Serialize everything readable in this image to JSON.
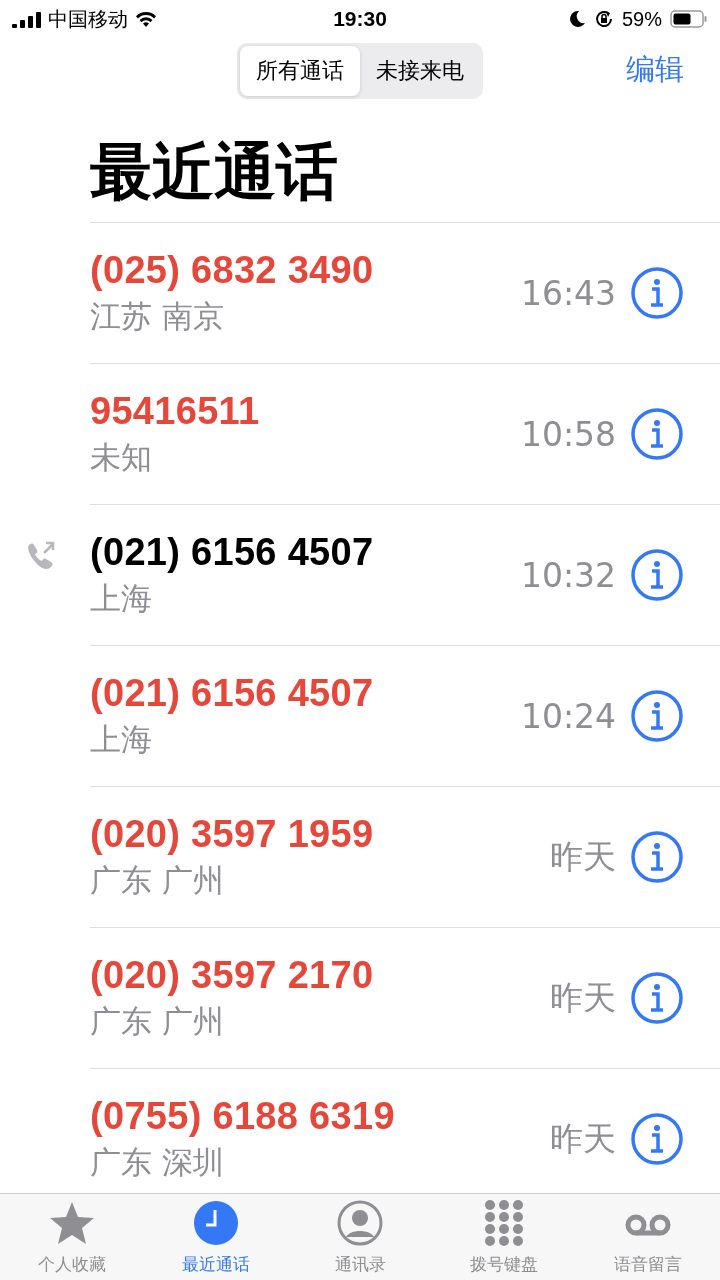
{
  "status_bar": {
    "carrier": "中国移动",
    "time": "19:30",
    "battery": "59%"
  },
  "segments": [
    {
      "label": "所有通话",
      "selected": true
    },
    {
      "label": "未接来电",
      "selected": false
    }
  ],
  "edit_button": "编辑",
  "title": "最近通话",
  "calls": [
    {
      "number": "(025) 6832 3490",
      "location": "江苏 南京",
      "time": "16:43",
      "missed": true,
      "outgoing": false
    },
    {
      "number": "95416511",
      "location": "未知",
      "time": "10:58",
      "missed": true,
      "outgoing": false
    },
    {
      "number": "(021) 6156 4507",
      "location": "上海",
      "time": "10:32",
      "missed": false,
      "outgoing": true
    },
    {
      "number": "(021) 6156 4507",
      "location": "上海",
      "time": "10:24",
      "missed": true,
      "outgoing": false
    },
    {
      "number": "(020) 3597 1959",
      "location": "广东 广州",
      "time": "昨天",
      "missed": true,
      "outgoing": false
    },
    {
      "number": "(020) 3597 2170",
      "location": "广东 广州",
      "time": "昨天",
      "missed": true,
      "outgoing": false
    },
    {
      "number": "(0755) 6188 6319",
      "location": "广东 深圳",
      "time": "昨天",
      "missed": true,
      "outgoing": false
    }
  ],
  "tab_bar": [
    {
      "kind": "star",
      "label": "个人收藏",
      "selected": false
    },
    {
      "kind": "clock",
      "label": "最近通话",
      "selected": true
    },
    {
      "kind": "person",
      "label": "通讯录",
      "selected": false
    },
    {
      "kind": "keypad",
      "label": "拨号键盘",
      "selected": false
    },
    {
      "kind": "voicemail",
      "label": "语音留言",
      "selected": false
    }
  ]
}
